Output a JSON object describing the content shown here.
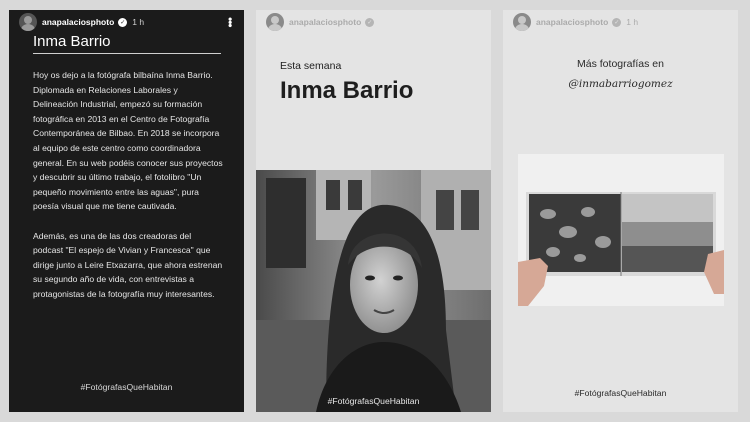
{
  "story": {
    "username": "anapalaciosphoto",
    "verified_icon": "verified-badge-icon",
    "time": "1 h",
    "more_icon": "more-vertical-icon"
  },
  "panel1": {
    "title": "Inma Barrio",
    "paragraphs": [
      "Hoy os dejo a la fotógrafa bilbaína Inma Barrio. Diplomada en Relaciones Laborales y Delineación Industrial, empezó su formación fotográfica en 2013 en el Centro de Fotografía Contemporánea de Bilbao. En 2018 se incorpora al equipo de este centro como coordinadora general. En su web podéis conocer sus proyectos y descubrir su último trabajo, el fotolibro \"Un pequeño movimiento entre las aguas\", pura poesía visual que me tiene cautivada.",
      "Además, es una de las dos creadoras del podcast \"El espejo de Vivian y Francesca\" que dirige junto a Leire Etxazarra, que ahora estrenan su segundo año de vida, con entrevistas a protagonistas de la fotografía muy interesantes."
    ],
    "hashtag": "#FotógrafasQueHabitan"
  },
  "panel2": {
    "subtitle": "Esta semana",
    "name": "Inma Barrio",
    "hashtag": "#FotógrafasQueHabitan"
  },
  "panel3": {
    "line1": "Más fotografías en",
    "handle": "@inmabarriogomez",
    "hashtag": "#FotógrafasQueHabitan"
  }
}
